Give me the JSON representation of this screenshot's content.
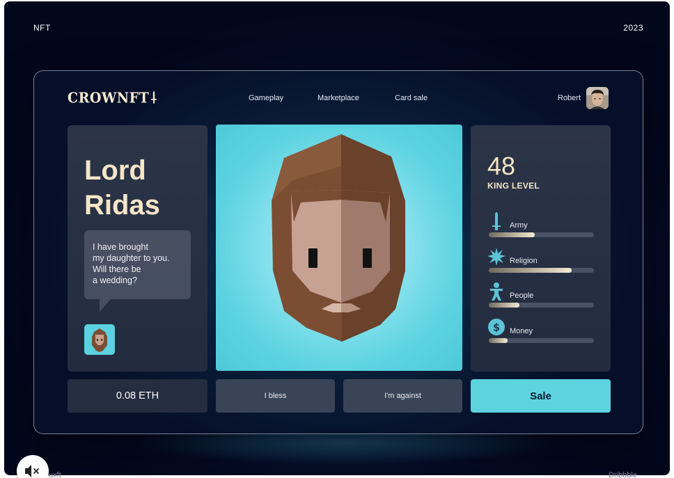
{
  "corner": {
    "left_label": "NFT",
    "right_label": "2023"
  },
  "header": {
    "logo": "CROWNFT",
    "nav": [
      {
        "label": "Gameplay"
      },
      {
        "label": "Marketplace"
      },
      {
        "label": "Card sale"
      }
    ],
    "user": {
      "name": "Robert"
    }
  },
  "character": {
    "name_line1": "Lord",
    "name_line2": "Ridas",
    "quote": "I have brought\nmy daughter to you.\nWill there be\na wedding?"
  },
  "stats": {
    "king_level": "48",
    "king_level_label": "KING LEVEL",
    "items": [
      {
        "label": "Army",
        "icon": "sword-icon",
        "value": 0.44
      },
      {
        "label": "Religion",
        "icon": "star-burst-icon",
        "value": 0.79
      },
      {
        "label": "People",
        "icon": "person-icon",
        "value": 0.29
      },
      {
        "label": "Money",
        "icon": "coin-icon",
        "value": 0.18
      }
    ]
  },
  "actions": {
    "price": "0.08 ETH",
    "bless_label": "I bless",
    "against_label": "I'm against",
    "sale_label": "Sale"
  },
  "footer": {
    "left": "uxft",
    "right": "Dribbble"
  },
  "colors": {
    "accent": "#5dd3e0",
    "cream": "#f5e6c8",
    "panel": "#2c3447",
    "background": "#040a24"
  }
}
